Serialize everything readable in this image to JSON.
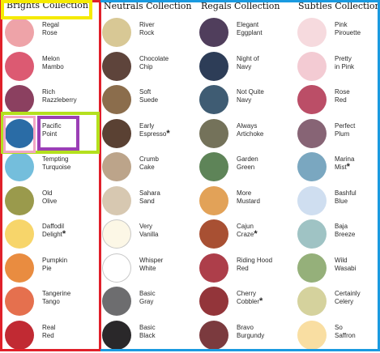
{
  "collections": [
    {
      "title": "Brights Collection",
      "swatches": [
        {
          "name": [
            "Regal",
            "Rose"
          ],
          "color": "#eea3a8",
          "star": false
        },
        {
          "name": [
            "Melon",
            "Mambo"
          ],
          "color": "#dc5a72",
          "star": false
        },
        {
          "name": [
            "Rich",
            "Razzleberry"
          ],
          "color": "#8b4060",
          "star": false
        },
        {
          "name": [
            "Pacific",
            "Point"
          ],
          "color": "#2a6ca6",
          "star": false
        },
        {
          "name": [
            "Tempting",
            "Turquoise"
          ],
          "color": "#74bedc",
          "star": false
        },
        {
          "name": [
            "Old",
            "Olive"
          ],
          "color": "#9a9a4c",
          "star": false
        },
        {
          "name": [
            "Daffodil",
            "Delight"
          ],
          "color": "#f7d56a",
          "star": true
        },
        {
          "name": [
            "Pumpkin",
            "Pie"
          ],
          "color": "#e98c40",
          "star": false
        },
        {
          "name": [
            "Tangerine",
            "Tango"
          ],
          "color": "#e5704e",
          "star": false
        },
        {
          "name": [
            "Real",
            "Red"
          ],
          "color": "#c12a33",
          "star": false
        }
      ]
    },
    {
      "title": "Neutrals Collection",
      "swatches": [
        {
          "name": [
            "River",
            "Rock"
          ],
          "color": "#d8c895",
          "star": false
        },
        {
          "name": [
            "Chocolate",
            "Chip"
          ],
          "color": "#5e443b",
          "star": false
        },
        {
          "name": [
            "Soft",
            "Suede"
          ],
          "color": "#8b6d4c",
          "star": false
        },
        {
          "name": [
            "Early",
            "Espresso"
          ],
          "color": "#5a4133",
          "star": true
        },
        {
          "name": [
            "Crumb",
            "Cake"
          ],
          "color": "#bca48a",
          "star": false
        },
        {
          "name": [
            "Sahara",
            "Sand"
          ],
          "color": "#d7c8b1",
          "star": false
        },
        {
          "name": [
            "Very",
            "Vanilla"
          ],
          "color": "#fcf7e6",
          "star": false
        },
        {
          "name": [
            "Whisper",
            "White"
          ],
          "color": "#ffffff",
          "star": false
        },
        {
          "name": [
            "Basic",
            "Gray"
          ],
          "color": "#6d6d6f",
          "star": false
        },
        {
          "name": [
            "Basic",
            "Black"
          ],
          "color": "#2a282a",
          "star": false
        }
      ]
    },
    {
      "title": "Regals Collection",
      "swatches": [
        {
          "name": [
            "Elegant",
            "Eggplant"
          ],
          "color": "#503e5c",
          "star": false
        },
        {
          "name": [
            "Night of",
            "Navy"
          ],
          "color": "#2d3d57",
          "star": false
        },
        {
          "name": [
            "Not Quite",
            "Navy"
          ],
          "color": "#3f5c73",
          "star": false
        },
        {
          "name": [
            "Always",
            "Artichoke"
          ],
          "color": "#74725a",
          "star": false
        },
        {
          "name": [
            "Garden",
            "Green"
          ],
          "color": "#5e8458",
          "star": false
        },
        {
          "name": [
            "More",
            "Mustard"
          ],
          "color": "#e2a258",
          "star": false
        },
        {
          "name": [
            "Cajun",
            "Craze"
          ],
          "color": "#a85033",
          "star": true
        },
        {
          "name": [
            "Riding Hood",
            "Red"
          ],
          "color": "#ad3e4a",
          "star": false
        },
        {
          "name": [
            "Cherry",
            "Cobbler"
          ],
          "color": "#93353a",
          "star": true
        },
        {
          "name": [
            "Bravo",
            "Burgundy"
          ],
          "color": "#7b3a3e",
          "star": false
        }
      ]
    },
    {
      "title": "Subtles Collection",
      "swatches": [
        {
          "name": [
            "Pink",
            "Pirouette"
          ],
          "color": "#f6dade",
          "star": false
        },
        {
          "name": [
            "Pretty",
            "in Pink"
          ],
          "color": "#f3cbd3",
          "star": false
        },
        {
          "name": [
            "Rose",
            "Red"
          ],
          "color": "#bb4e67",
          "star": false
        },
        {
          "name": [
            "Perfect",
            "Plum"
          ],
          "color": "#876475",
          "star": false
        },
        {
          "name": [
            "Marina",
            "Mist"
          ],
          "color": "#7aa7c0",
          "star": true
        },
        {
          "name": [
            "Bashful",
            "Blue"
          ],
          "color": "#cfdef0",
          "star": false
        },
        {
          "name": [
            "Baja",
            "Breeze"
          ],
          "color": "#9fc3c4",
          "star": false
        },
        {
          "name": [
            "Wild",
            "Wasabi"
          ],
          "color": "#95b07a",
          "star": false
        },
        {
          "name": [
            "Certainly",
            "Celery"
          ],
          "color": "#d5d29d",
          "star": false
        },
        {
          "name": [
            "So",
            "Saffron"
          ],
          "color": "#f9dea2",
          "star": false
        }
      ]
    }
  ],
  "annotation_colors": {
    "red": "#e0202a",
    "blue": "#1a9ae0",
    "yellow": "#f5ea00",
    "pink": "#f2a6c4",
    "lime": "#b4e01e",
    "purple": "#9b3fb5"
  }
}
